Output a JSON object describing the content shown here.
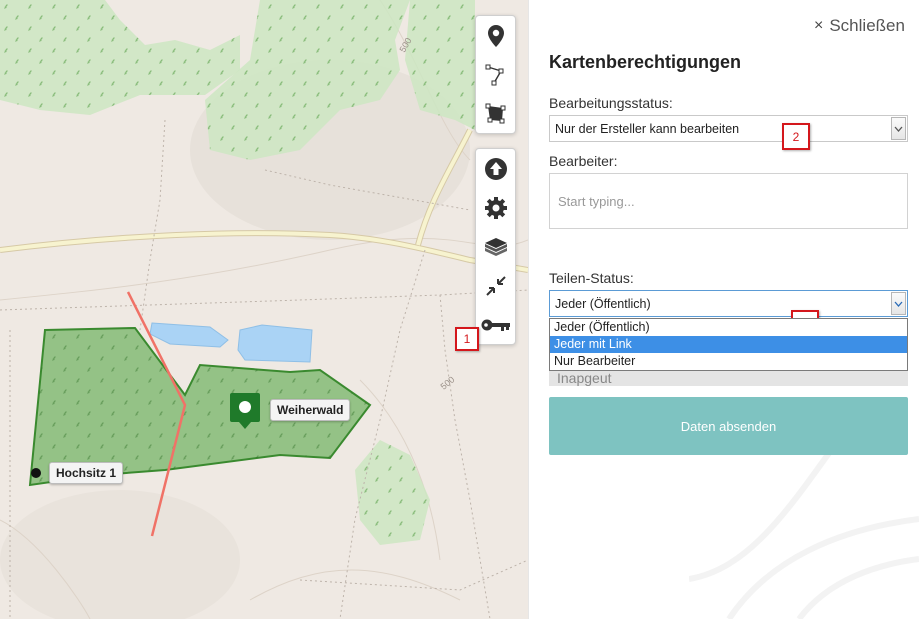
{
  "map": {
    "feature_label": "Weiherwald",
    "point_label": "Hochsitz 1",
    "contour_labels": [
      "500",
      "500"
    ],
    "colors": {
      "forest": "#5aa94a",
      "water": "#aad3f5",
      "path": "#f07267",
      "road": "#f5f0c8"
    }
  },
  "toolbar": {
    "draw_tools": [
      {
        "icon": "map-marker-icon",
        "label": ""
      },
      {
        "icon": "polyline-icon",
        "label": ""
      },
      {
        "icon": "polygon-icon",
        "label": ""
      }
    ],
    "actions": [
      {
        "icon": "upload-icon",
        "label": ""
      },
      {
        "icon": "gear-icon",
        "label": ""
      },
      {
        "icon": "layers-icon",
        "label": ""
      },
      {
        "icon": "collapse-icon",
        "label": ""
      },
      {
        "icon": "key-icon",
        "label": ""
      }
    ]
  },
  "markers": [
    "1",
    "2",
    "3"
  ],
  "panel": {
    "close_icon": "×",
    "close_label": "Schließen",
    "title": "Kartenberechtigungen",
    "edit_status": {
      "label": "Bearbeitungsstatus:",
      "value": "Nur der Ersteller kann bearbeiten"
    },
    "editors": {
      "label": "Bearbeiter:",
      "placeholder": "Start typing..."
    },
    "share_status": {
      "label": "Teilen-Status:",
      "value": "Jeder (Öffentlich)",
      "options": [
        "Jeder (Öffentlich)",
        "Jeder mit Link",
        "Nur Bearbeiter"
      ],
      "highlighted_index": 1
    },
    "hidden_field_text": "Inapgeut",
    "submit_label": "Daten absenden",
    "colors": {
      "submit": "#7ec3c1",
      "highlight": "#3d8fe6",
      "marker": "#d4171c"
    }
  }
}
